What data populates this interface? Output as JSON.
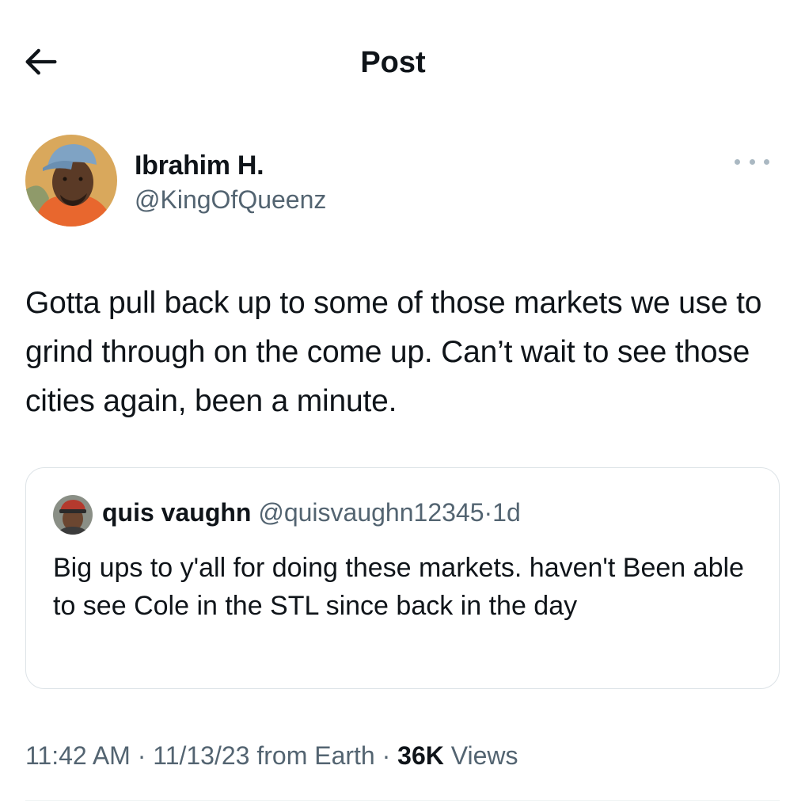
{
  "header": {
    "title": "Post",
    "back_icon": "arrow-left-icon"
  },
  "author": {
    "name": "Ibrahim H.",
    "handle": "@KingOfQueenz",
    "more_icon": "more-horizontal-icon"
  },
  "tweet": {
    "text": "Gotta pull back up to some of those markets we use to grind through on the come up. Can’t wait to see those cities again, been a minute."
  },
  "quote": {
    "name": "quis vaughn",
    "handle": "@quisvaughn12345",
    "separator": "·",
    "age": "1d",
    "text": "Big ups to y'all for doing these markets. haven't Been able to see Cole in the STL since back in the day"
  },
  "meta": {
    "time": "11:42 AM",
    "sep1": "·",
    "date": "11/13/23",
    "from": "from Earth",
    "sep2": "·",
    "views_count": "36K",
    "views_label": "Views"
  },
  "colors": {
    "text": "#0f1419",
    "secondary": "#536471",
    "border": "#dde3e7"
  }
}
